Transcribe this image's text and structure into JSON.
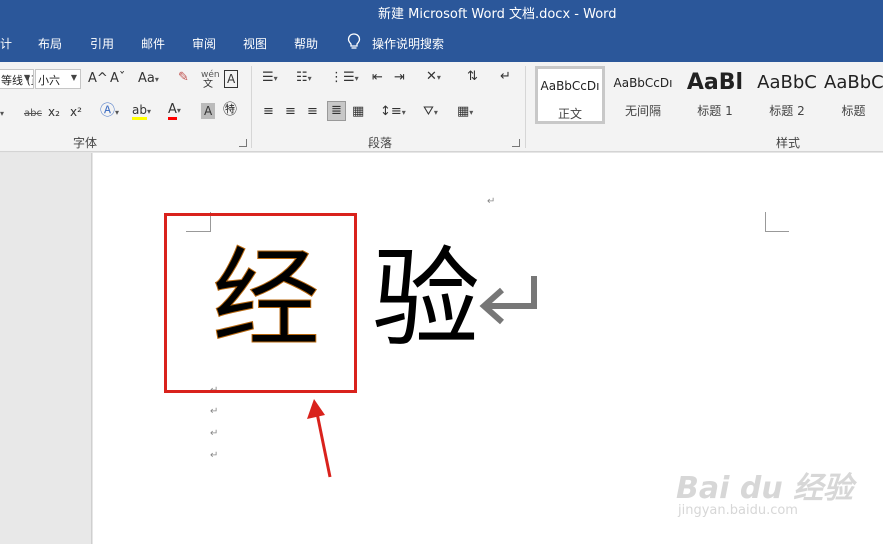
{
  "window": {
    "title": "新建 Microsoft Word 文档.docx  -  Word"
  },
  "ribbon_tabs": [
    {
      "label": "计"
    },
    {
      "label": "布局"
    },
    {
      "label": "引用"
    },
    {
      "label": "邮件"
    },
    {
      "label": "审阅"
    },
    {
      "label": "视图"
    },
    {
      "label": "帮助"
    }
  ],
  "tell_me": {
    "label": "操作说明搜索",
    "icon": "lightbulb-icon"
  },
  "font_group": {
    "font_name": "等线 (正文",
    "font_size": "小六",
    "label": "字体",
    "tools": {
      "grow": "A^",
      "shrink": "Aˇ",
      "change_case": "Aa",
      "pinyin_top": "wén",
      "pinyin_bottom": "文",
      "strikethrough": "abc",
      "subscript": "x₂",
      "superscript": "x²"
    }
  },
  "paragraph_group": {
    "label": "段落"
  },
  "styles_group": {
    "label": "样式",
    "styles": [
      {
        "sample": "AaBbCcDı",
        "name": "正文",
        "selected": true
      },
      {
        "sample": "AaBbCcDı",
        "name": "无间隔",
        "selected": false
      },
      {
        "sample": "AaBl",
        "name": "标题 1",
        "selected": false
      },
      {
        "sample": "AaBbC",
        "name": "标题 2",
        "selected": false
      },
      {
        "sample": "AaBbC",
        "name": "标题",
        "selected": false
      }
    ]
  },
  "document": {
    "char_highlighted": "经",
    "char_normal": "验",
    "para_mark": "↵"
  },
  "annotation": {
    "box_color": "#d9221c",
    "arrow_color": "#d9221c"
  },
  "watermark": {
    "logo": "Bai du 经验",
    "url": "jingyan.baidu.com"
  },
  "colors": {
    "ribbon_blue": "#2b579a",
    "text_highlight": "#ffff00",
    "font_color": "#ff0000"
  }
}
